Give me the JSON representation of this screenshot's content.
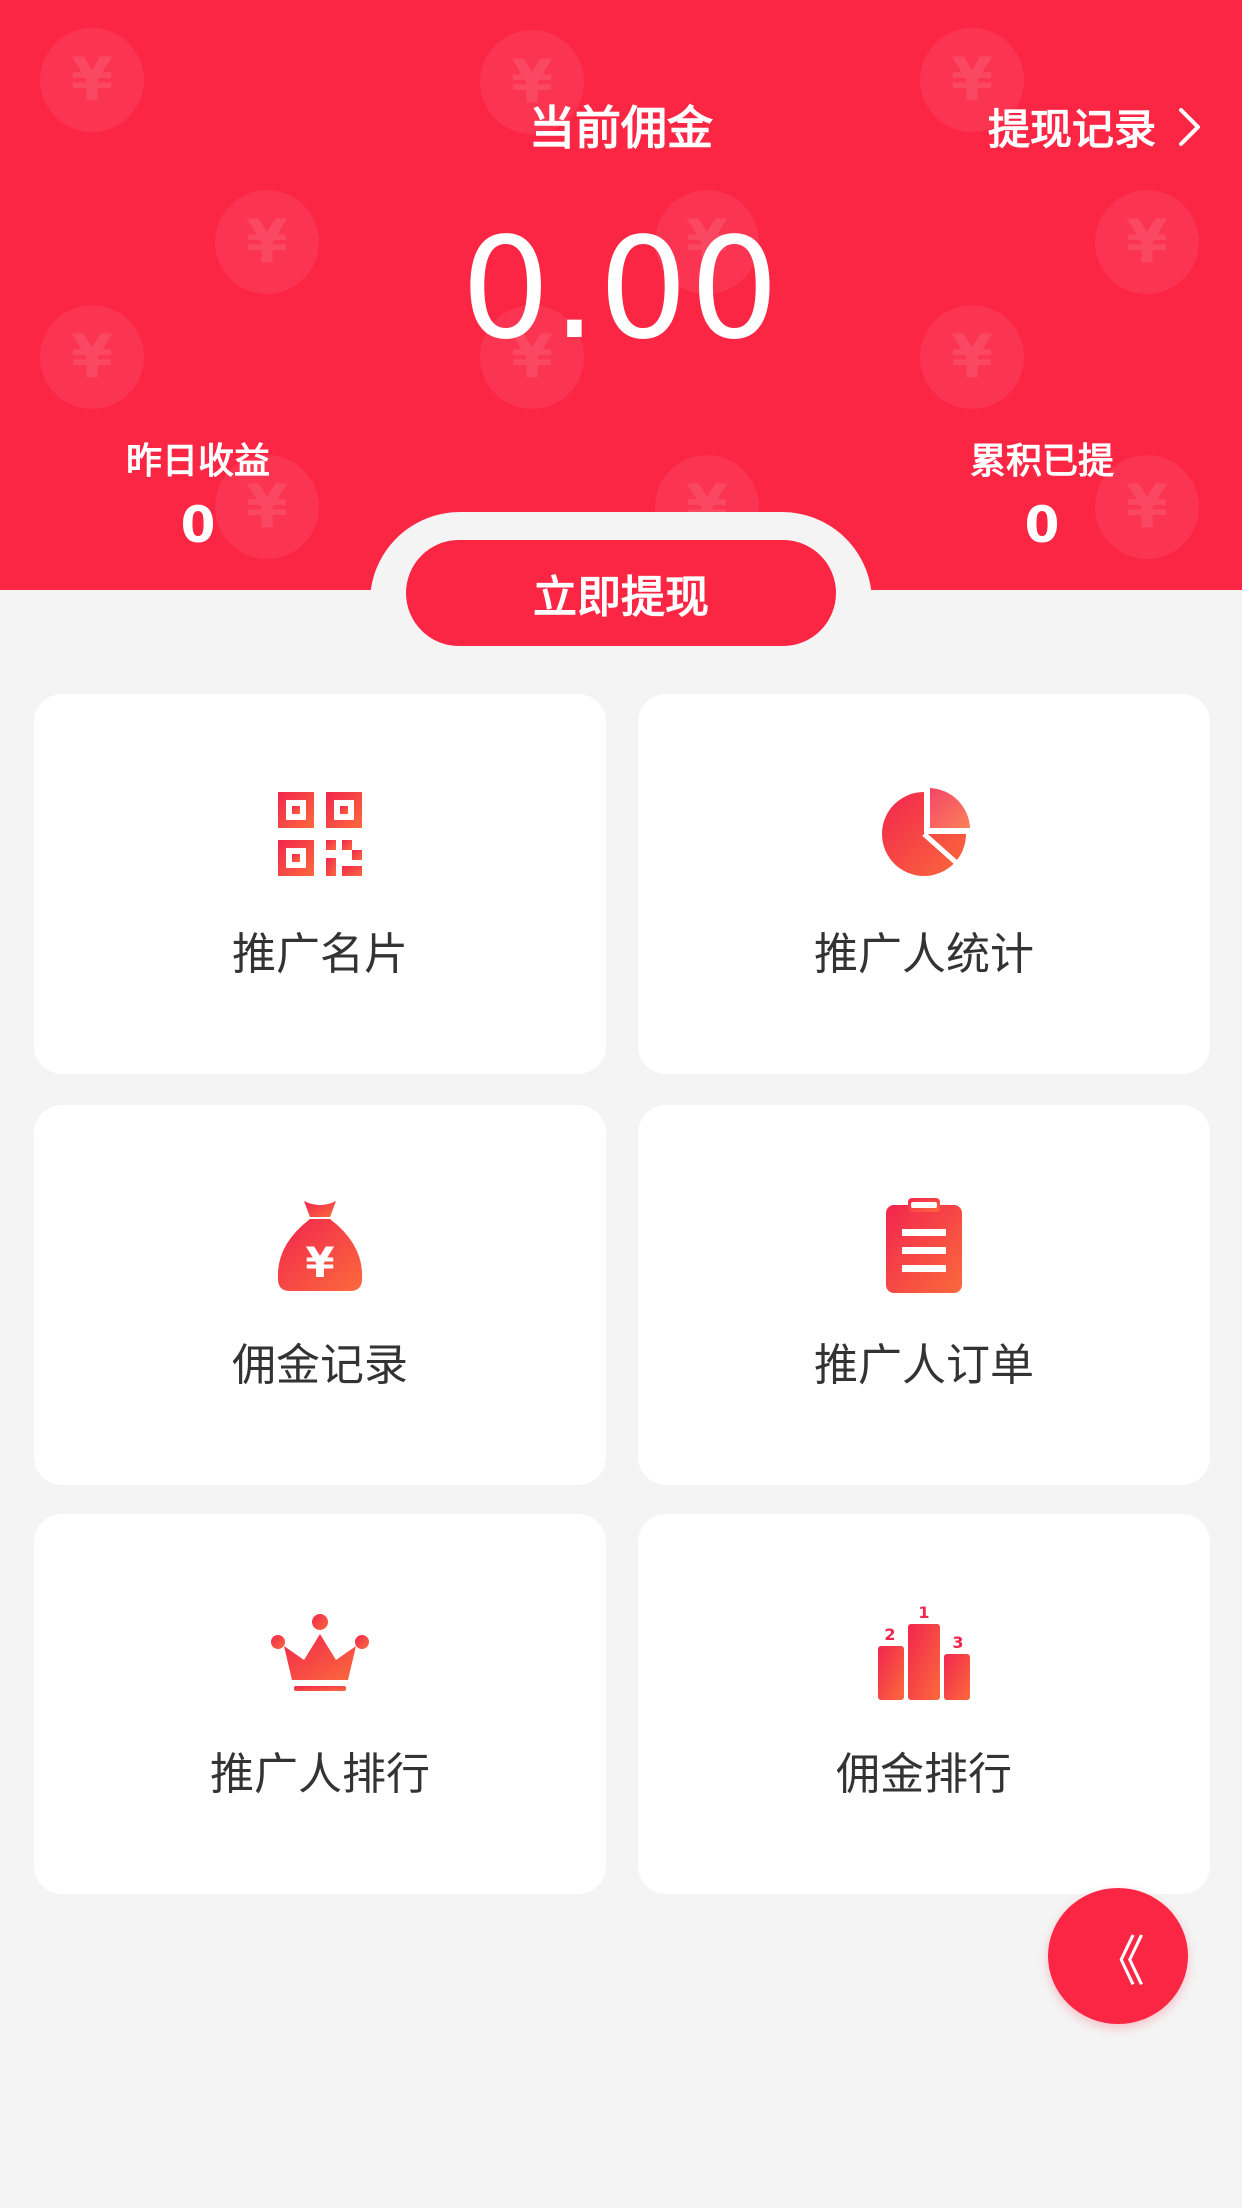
{
  "header": {
    "title": "当前佣金",
    "record_link": "提现记录",
    "amount": "0.00",
    "yesterday_label": "昨日收益",
    "yesterday_value": "0",
    "total_label": "累积已提",
    "total_value": "0",
    "withdraw_button": "立即提现"
  },
  "menu": [
    {
      "label": "推广名片",
      "icon": "qr-code-icon"
    },
    {
      "label": "推广人统计",
      "icon": "pie-chart-icon"
    },
    {
      "label": "佣金记录",
      "icon": "money-bag-icon"
    },
    {
      "label": "推广人订单",
      "icon": "clipboard-icon"
    },
    {
      "label": "推广人排行",
      "icon": "crown-icon"
    },
    {
      "label": "佣金排行",
      "icon": "podium-icon"
    }
  ],
  "fab": {
    "label": "《",
    "icon": "double-chevron-left-icon"
  },
  "colors": {
    "primary": "#fb2544",
    "icon_gradient_start": "#f2254e",
    "icon_gradient_end": "#fb6a3c",
    "background": "#f4f4f4"
  }
}
